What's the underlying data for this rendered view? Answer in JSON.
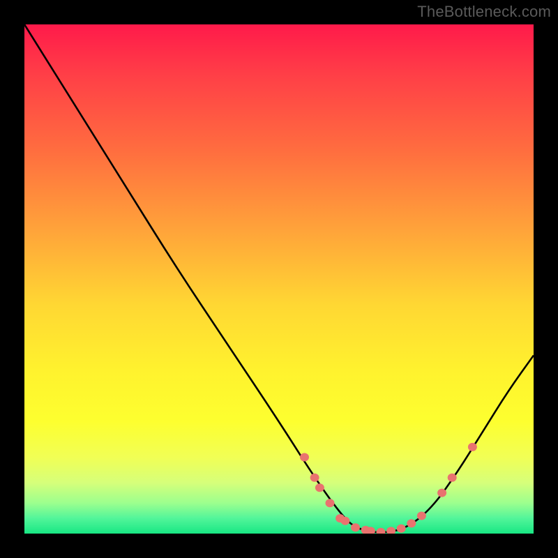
{
  "watermark": "TheBottleneck.com",
  "chart_data": {
    "type": "line",
    "title": "",
    "xlabel": "",
    "ylabel": "",
    "xlim": [
      0,
      100
    ],
    "ylim": [
      0,
      100
    ],
    "series": [
      {
        "name": "curve",
        "x": [
          0,
          10,
          20,
          30,
          40,
          50,
          57,
          62,
          65,
          70,
          75,
          80,
          85,
          90,
          95,
          100
        ],
        "y": [
          100,
          84,
          68,
          52,
          37,
          22,
          11,
          4,
          1,
          0,
          1,
          5,
          12,
          20,
          28,
          35
        ]
      }
    ],
    "markers": [
      {
        "x": 55,
        "y": 15
      },
      {
        "x": 57,
        "y": 11
      },
      {
        "x": 58,
        "y": 9
      },
      {
        "x": 60,
        "y": 6
      },
      {
        "x": 62,
        "y": 3
      },
      {
        "x": 63,
        "y": 2.5
      },
      {
        "x": 65,
        "y": 1.2
      },
      {
        "x": 67,
        "y": 0.7
      },
      {
        "x": 68,
        "y": 0.5
      },
      {
        "x": 70,
        "y": 0.3
      },
      {
        "x": 72,
        "y": 0.5
      },
      {
        "x": 74,
        "y": 1
      },
      {
        "x": 76,
        "y": 2
      },
      {
        "x": 78,
        "y": 3.5
      },
      {
        "x": 82,
        "y": 8
      },
      {
        "x": 84,
        "y": 11
      },
      {
        "x": 88,
        "y": 17
      }
    ],
    "marker_color": "#e9736f",
    "curve_color": "#000000"
  }
}
